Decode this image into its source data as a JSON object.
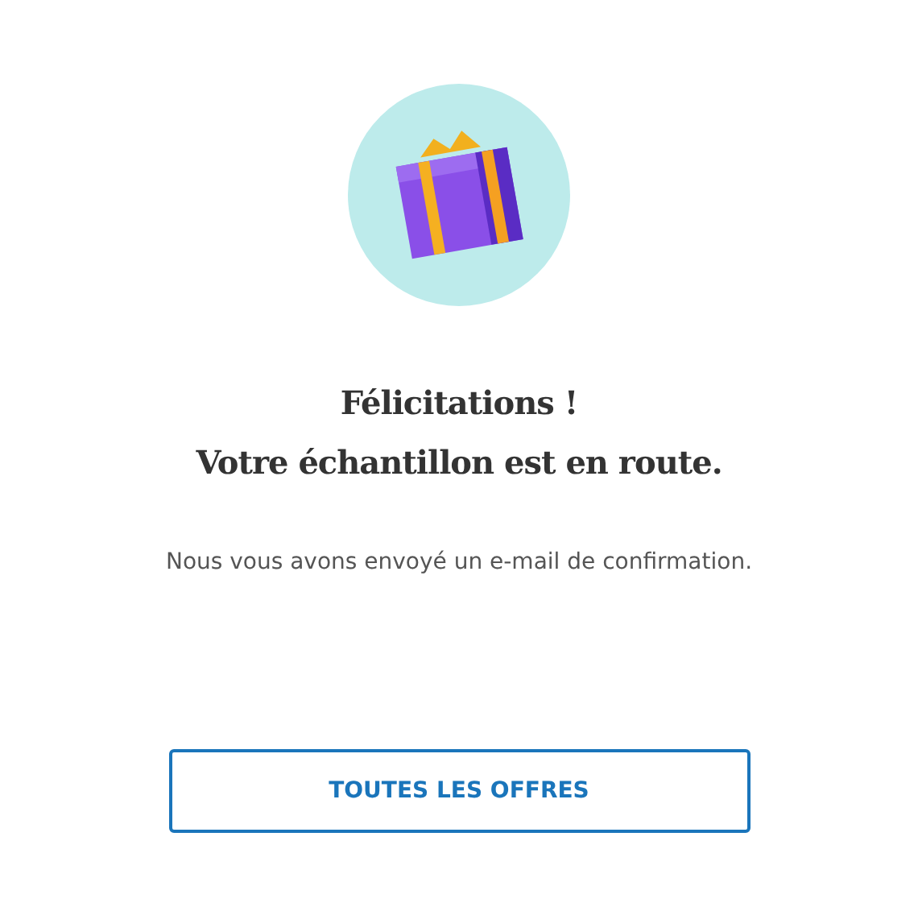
{
  "heading": {
    "lines": [
      "Félicitations !",
      "Votre échantillon est en route."
    ]
  },
  "message": "Nous vous avons envoyé un e-mail de confirmation.",
  "button": {
    "label": "TOUTES LES OFFRES"
  }
}
